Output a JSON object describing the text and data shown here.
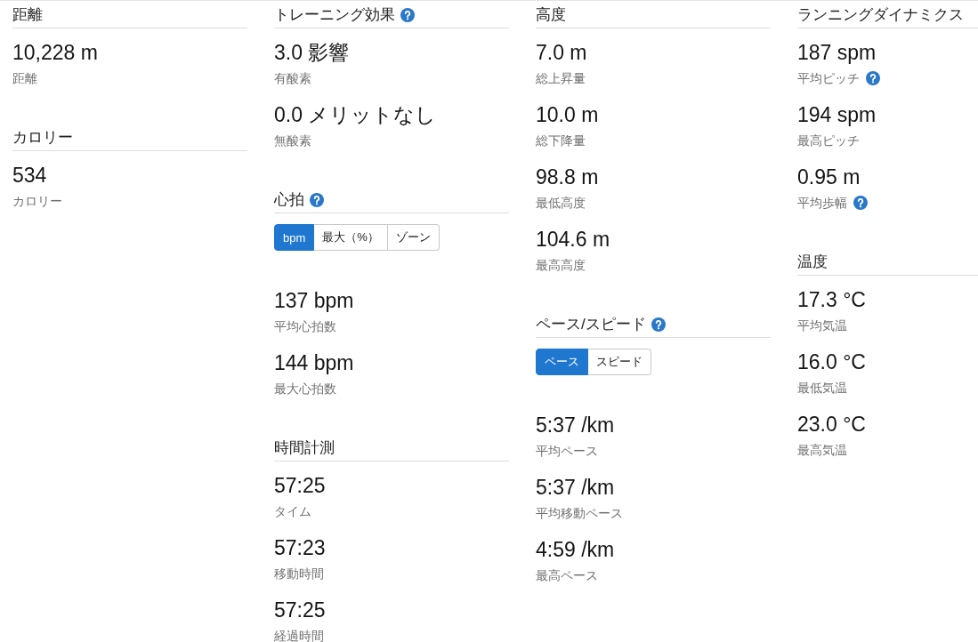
{
  "columns": [
    {
      "sections": [
        {
          "title": "距離",
          "help": false,
          "stats": [
            {
              "value": "10,228 m",
              "label": "距離",
              "help": false
            }
          ]
        },
        {
          "title": "カロリー",
          "help": false,
          "stats": [
            {
              "value": "534",
              "label": "カロリー",
              "help": false
            }
          ]
        }
      ]
    },
    {
      "sections": [
        {
          "title": "トレーニング効果",
          "help": true,
          "stats": [
            {
              "value": "3.0 影響",
              "label": "有酸素",
              "help": false
            },
            {
              "value": "0.0 メリットなし",
              "label": "無酸素",
              "help": false
            }
          ]
        },
        {
          "title": "心拍",
          "help": true,
          "toggle": [
            {
              "label": "bpm",
              "selected": true
            },
            {
              "label": "最大（%）",
              "selected": false
            },
            {
              "label": "ゾーン",
              "selected": false
            }
          ],
          "stats": [
            {
              "value": "137 bpm",
              "label": "平均心拍数",
              "help": false
            },
            {
              "value": "144 bpm",
              "label": "最大心拍数",
              "help": false
            }
          ]
        },
        {
          "title": "時間計測",
          "help": false,
          "stats": [
            {
              "value": "57:25",
              "label": "タイム",
              "help": false
            },
            {
              "value": "57:23",
              "label": "移動時間",
              "help": false
            },
            {
              "value": "57:25",
              "label": "経過時間",
              "help": false
            }
          ]
        }
      ]
    },
    {
      "sections": [
        {
          "title": "高度",
          "help": false,
          "stats": [
            {
              "value": "7.0 m",
              "label": "総上昇量",
              "help": false
            },
            {
              "value": "10.0 m",
              "label": "総下降量",
              "help": false
            },
            {
              "value": "98.8 m",
              "label": "最低高度",
              "help": false
            },
            {
              "value": "104.6 m",
              "label": "最高高度",
              "help": false
            }
          ]
        },
        {
          "title": "ペース/スピード",
          "help": true,
          "toggle": [
            {
              "label": "ペース",
              "selected": true
            },
            {
              "label": "スピード",
              "selected": false
            }
          ],
          "stats": [
            {
              "value": "5:37 /km",
              "label": "平均ペース",
              "help": false
            },
            {
              "value": "5:37 /km",
              "label": "平均移動ペース",
              "help": false
            },
            {
              "value": "4:59 /km",
              "label": "最高ペース",
              "help": false
            }
          ]
        }
      ]
    },
    {
      "sections": [
        {
          "title": "ランニングダイナミクス",
          "help": false,
          "stats": [
            {
              "value": "187 spm",
              "label": "平均ピッチ",
              "help": true
            },
            {
              "value": "194 spm",
              "label": "最高ピッチ",
              "help": false
            },
            {
              "value": "0.95 m",
              "label": "平均歩幅",
              "help": true
            }
          ]
        },
        {
          "title": "温度",
          "help": false,
          "stats": [
            {
              "value": "17.3 °C",
              "label": "平均気温",
              "help": false
            },
            {
              "value": "16.0 °C",
              "label": "最低気温",
              "help": false
            },
            {
              "value": "23.0 °C",
              "label": "最高気温",
              "help": false
            }
          ]
        }
      ]
    }
  ]
}
